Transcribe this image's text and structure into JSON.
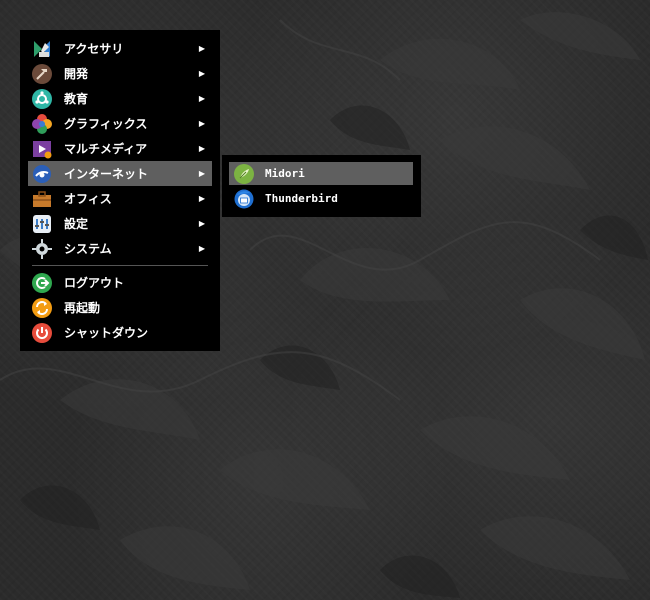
{
  "menu": {
    "items": [
      {
        "label": "アクセサリ",
        "icon": "accessories-icon",
        "submenu": true
      },
      {
        "label": "開発",
        "icon": "development-icon",
        "submenu": true
      },
      {
        "label": "教育",
        "icon": "education-icon",
        "submenu": true
      },
      {
        "label": "グラフィックス",
        "icon": "graphics-icon",
        "submenu": true
      },
      {
        "label": "マルチメディア",
        "icon": "multimedia-icon",
        "submenu": true
      },
      {
        "label": "インターネット",
        "icon": "internet-icon",
        "submenu": true,
        "active": true
      },
      {
        "label": "オフィス",
        "icon": "office-icon",
        "submenu": true
      },
      {
        "label": "設定",
        "icon": "settings-icon",
        "submenu": true
      },
      {
        "label": "システム",
        "icon": "system-icon",
        "submenu": true
      }
    ],
    "actions": [
      {
        "label": "ログアウト",
        "icon": "logout-icon"
      },
      {
        "label": "再起動",
        "icon": "restart-icon"
      },
      {
        "label": "シャットダウン",
        "icon": "shutdown-icon"
      }
    ],
    "arrow": "▶"
  },
  "submenu": {
    "items": [
      {
        "label": "Midori",
        "icon": "midori-icon",
        "active": true
      },
      {
        "label": "Thunderbird",
        "icon": "thunderbird-icon"
      }
    ]
  },
  "colors": {
    "menu_bg": "#000000",
    "highlight": "#5f5f5f",
    "text": "#ffffff"
  }
}
